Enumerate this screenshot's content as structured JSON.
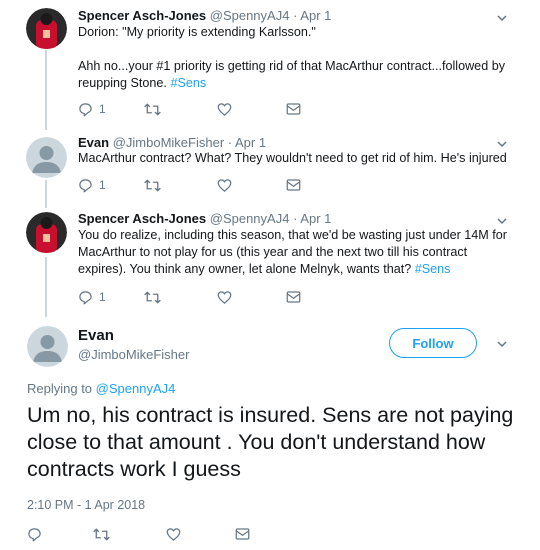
{
  "tweets": [
    {
      "name": "Spencer Asch-Jones",
      "handle": "@SpennyAJ4",
      "date": "· Apr 1",
      "paragraphs": [
        {
          "text": "Dorion: \"My priority is extending Karlsson.\"",
          "hashtag": ""
        },
        {
          "text": "Ahh no...your #1 priority is getting rid of that MacArthur contract...followed by reupping Stone. ",
          "hashtag": "#Sens"
        }
      ],
      "reply_count": "1",
      "avatar_color": "#c8102e"
    },
    {
      "name": "Evan",
      "handle": "@JimboMikeFisher",
      "date": "· Apr 1",
      "paragraphs": [
        {
          "text": "MacArthur contract? What? They wouldn't need to get rid of him. He's  injured",
          "hashtag": ""
        }
      ],
      "reply_count": "1",
      "avatar_color": "#ccd6dd"
    },
    {
      "name": "Spencer Asch-Jones",
      "handle": "@SpennyAJ4",
      "date": "· Apr 1",
      "paragraphs": [
        {
          "text": "You do realize, including this season, that we'd be wasting just under 14M for MacArthur to not play for us (this year and the next two till his contract expires). You think any owner, let alone Melnyk, wants that? ",
          "hashtag": "#Sens"
        }
      ],
      "reply_count": "1",
      "avatar_color": "#c8102e"
    }
  ],
  "focused": {
    "name": "Evan",
    "handle": "@JimboMikeFisher",
    "follow_label": "Follow",
    "replying_prefix": "Replying to ",
    "replying_to": "@SpennyAJ4",
    "text": "Um no, his contract is insured. Sens are not paying close to that amount . You don't understand how contracts work I guess",
    "timestamp": "2:10 PM - 1 Apr 2018"
  },
  "icons": {
    "reply": "reply-icon",
    "retweet": "retweet-icon",
    "like": "heart-icon",
    "dm": "envelope-icon",
    "caret": "chevron-down-icon"
  },
  "colors": {
    "accent": "#1da1f2",
    "secondary_text": "#657786",
    "thread_line": "#ccd6dd"
  }
}
